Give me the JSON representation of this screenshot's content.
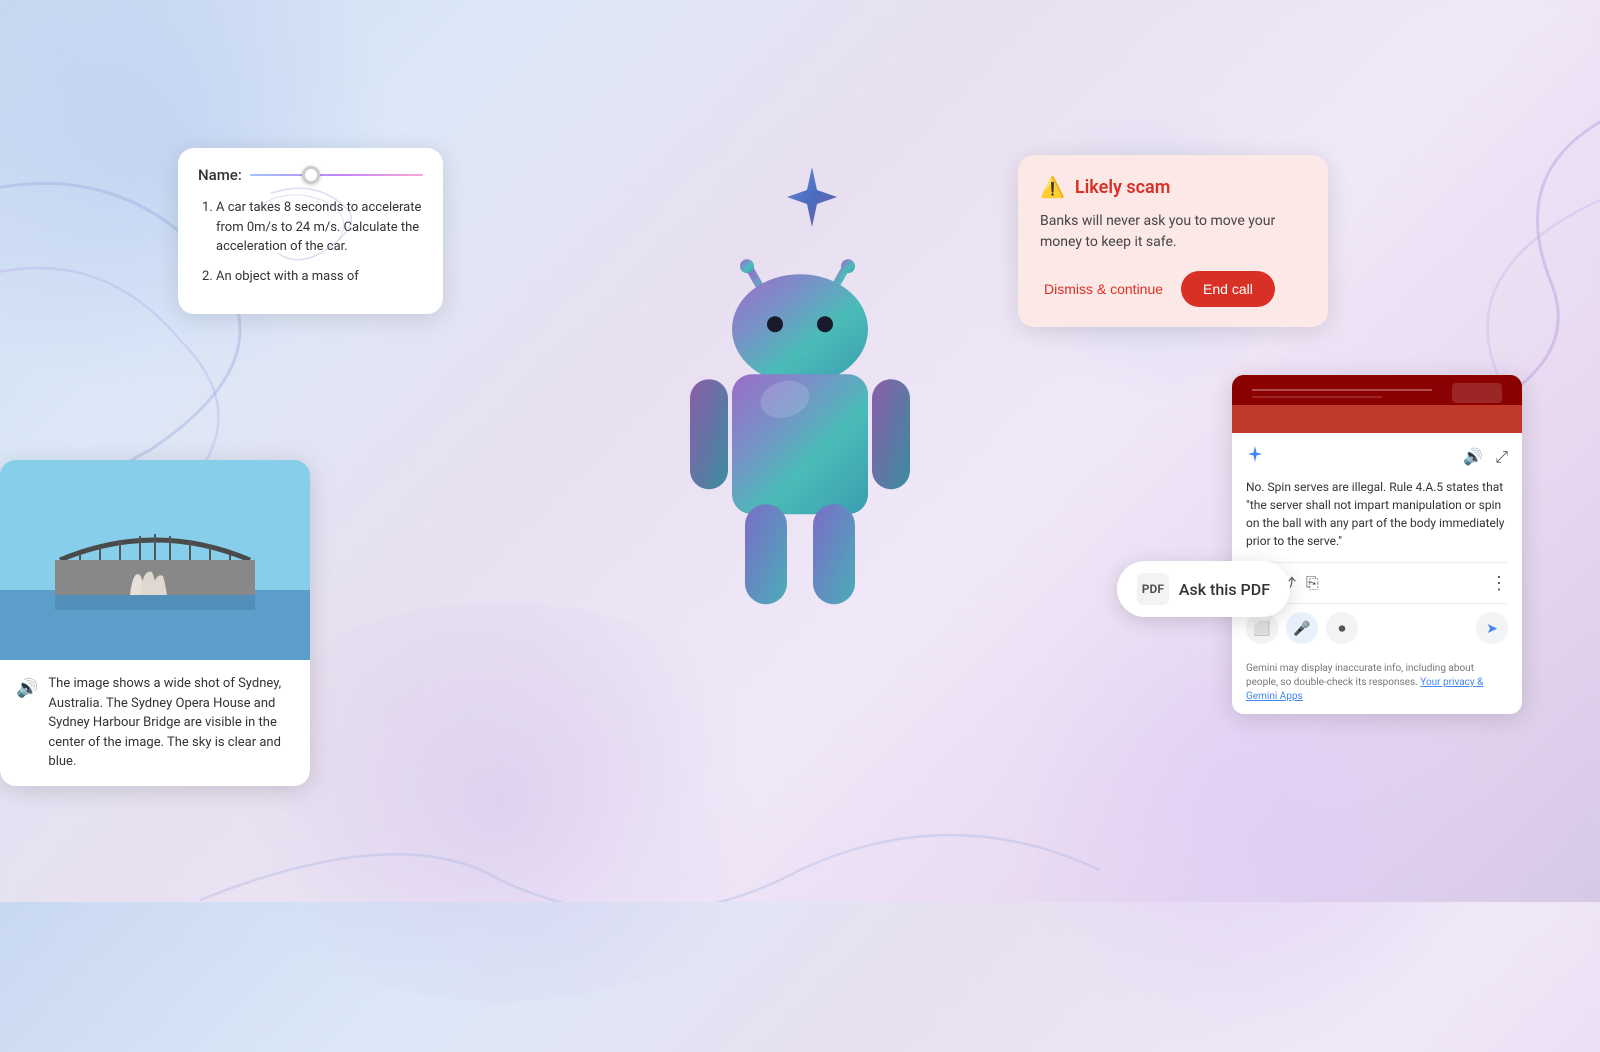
{
  "background": {
    "description": "Android AI features promotional image"
  },
  "quiz_card": {
    "name_label": "Name:",
    "items": [
      "A car takes 8 seconds to accelerate from 0m/s to 24 m/s. Calculate the acceleration of the car.",
      "An object with a mass of"
    ]
  },
  "sydney_card": {
    "caption": "The image shows a wide shot of Sydney, Australia. The Sydney Opera House and Sydney Harbour Bridge are visible in the center of the image. The sky is clear and blue."
  },
  "scam_card": {
    "title": "Likely scam",
    "body": "Banks will never ask you to move your money to keep it safe.",
    "dismiss_label": "Dismiss & continue",
    "end_call_label": "End call"
  },
  "browser_card": {
    "text": "No. Spin serves are illegal. Rule 4.A.5 states that \"the server shall not impart manipulation or spin on the ball with any part of the body immediately prior to the serve.\"",
    "footer": "Gemini may display inaccurate info, including about people, so double-check its responses.",
    "footer_link": "Your privacy & Gemini Apps"
  },
  "ask_pdf": {
    "label": "Ask this PDF",
    "icon_text": "PDF"
  },
  "icons": {
    "warning": "⚠",
    "speaker": "🔊",
    "gemini_star": "✦",
    "volume": "🔊",
    "external": "⤢",
    "copy": "⎘",
    "share": "⤴",
    "more": "⋮",
    "screen": "⬜",
    "mic": "🎤",
    "record": "⏺",
    "send": "➤"
  },
  "colors": {
    "scam_red": "#d93025",
    "scam_bg": "#fce8e6",
    "google_blue": "#4285f4",
    "white": "#ffffff",
    "dark_text": "#333333"
  }
}
